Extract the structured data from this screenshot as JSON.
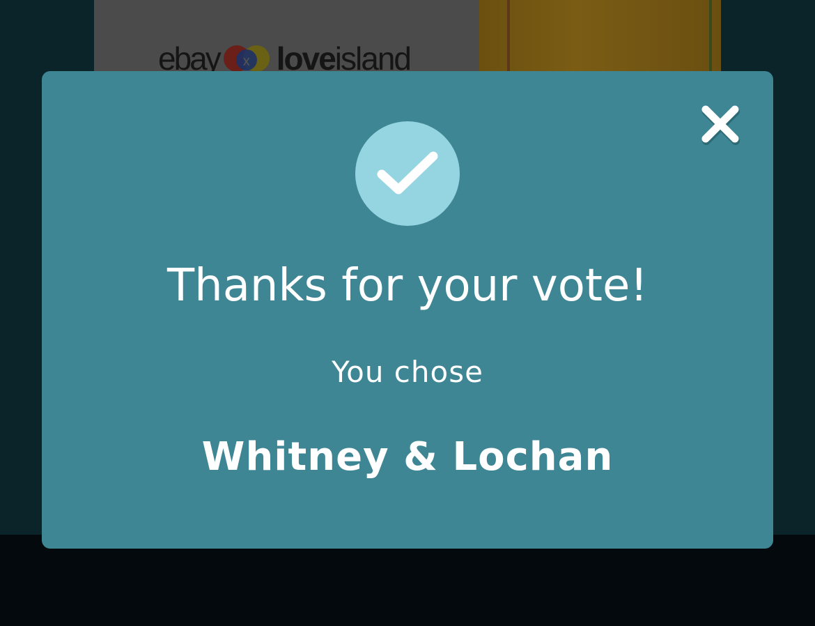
{
  "background": {
    "banner": {
      "logo_ebay": "ebay",
      "logo_x": "x",
      "logo_love": "love",
      "logo_island": "island"
    }
  },
  "modal": {
    "title": "Thanks for your vote!",
    "subtitle": "You chose",
    "choice": "Whitney & Lochan",
    "close_icon": "close-icon",
    "status_icon": "checkmark-icon"
  },
  "colors": {
    "modal_background": "#3e8694",
    "check_circle": "#95d4e1",
    "text": "#ffffff",
    "page_background": "#0a2429"
  }
}
